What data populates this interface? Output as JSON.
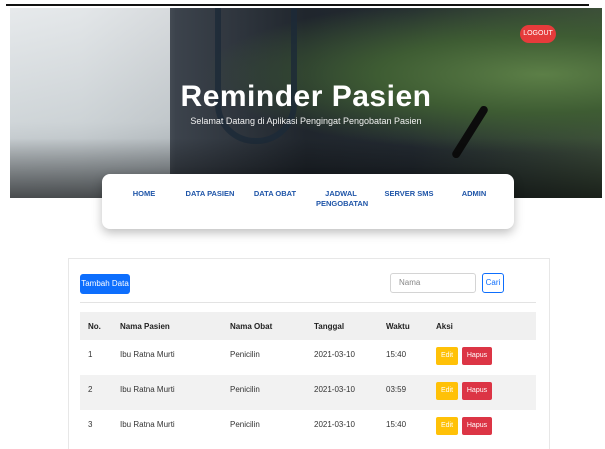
{
  "header": {
    "title": "Reminder Pasien",
    "subtitle": "Selamat Datang di Aplikasi Pengingat Pengobatan Pasien",
    "logout_label": "LOGOUT"
  },
  "nav": [
    {
      "label": "HOME"
    },
    {
      "label": "DATA PASIEN"
    },
    {
      "label": "DATA OBAT"
    },
    {
      "label": "JADWAL PENGOBATAN"
    },
    {
      "label": "SERVER SMS"
    },
    {
      "label": "ADMIN"
    }
  ],
  "toolbar": {
    "add_label": "Tambah Data",
    "search_placeholder": "Nama",
    "search_button": "Cari"
  },
  "table": {
    "headers": [
      "No.",
      "Nama Pasien",
      "Nama Obat",
      "Tanggal",
      "Waktu",
      "Aksi"
    ],
    "rows": [
      {
        "no": "1",
        "pasien": "Ibu Ratna Murti",
        "obat": "Penicilin",
        "tanggal": "2021-03-10",
        "waktu": "15:40"
      },
      {
        "no": "2",
        "pasien": "Ibu Ratna Murti",
        "obat": "Penicilin",
        "tanggal": "2021-03-10",
        "waktu": "03:59"
      },
      {
        "no": "3",
        "pasien": "Ibu Ratna Murti",
        "obat": "Penicilin",
        "tanggal": "2021-03-10",
        "waktu": "15:40"
      }
    ],
    "edit_label": "Edit",
    "delete_label": "Hapus"
  },
  "colors": {
    "primary": "#0d6efd",
    "nav_text": "#1f55a8",
    "edit": "#ffc107",
    "delete": "#dc3545",
    "logout": "#e63b3b"
  }
}
